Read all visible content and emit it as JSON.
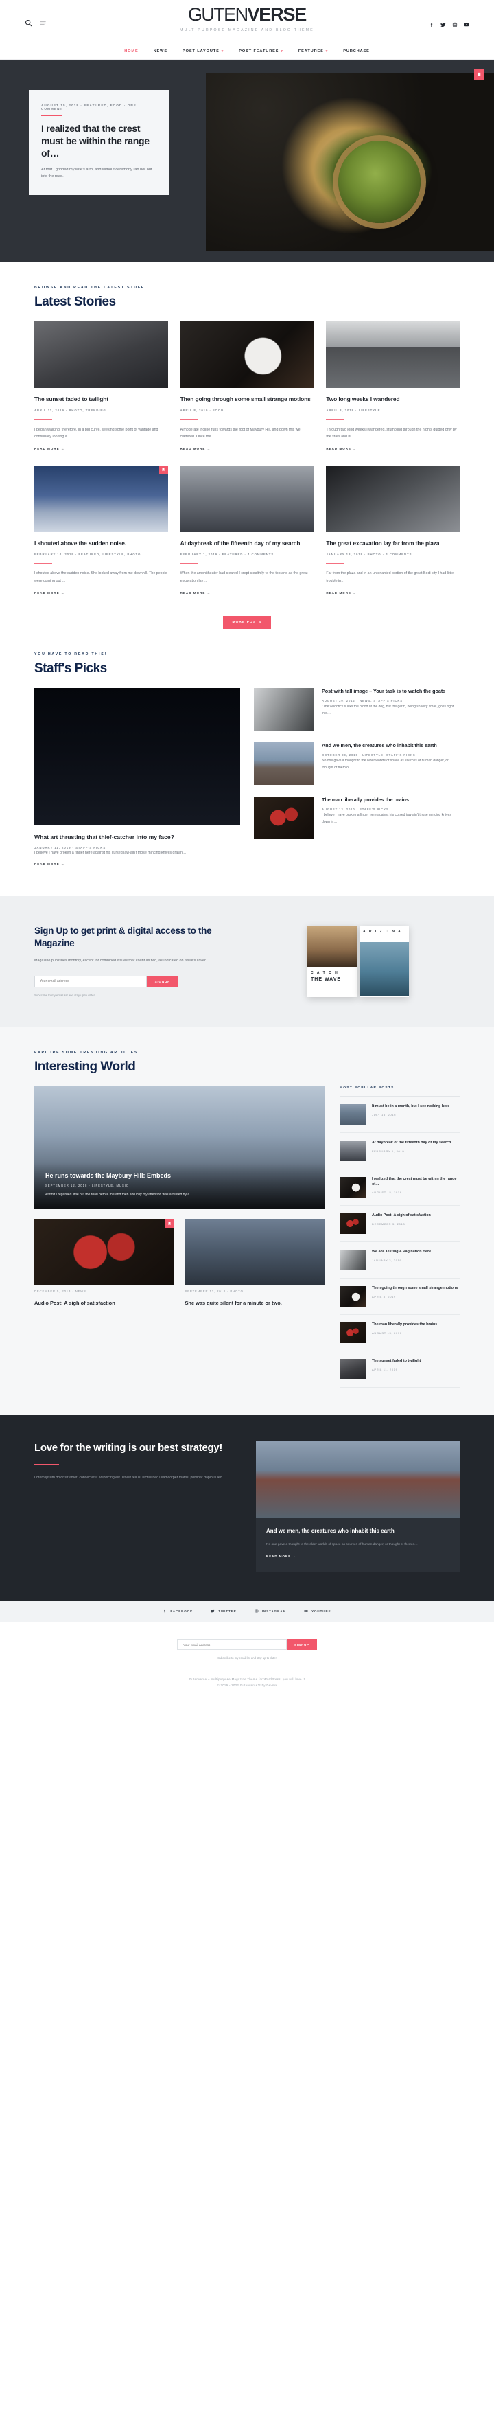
{
  "header": {
    "logo_thin": "GUTEN",
    "logo_bold": "VERSE",
    "tagline": "MULTIPURPOSE MAGAZINE AND BLOG THEME",
    "search_icon": "search-icon",
    "menu_icon": "hamburger-icon",
    "socials": [
      "facebook-icon",
      "twitter-icon",
      "instagram-icon",
      "youtube-icon"
    ],
    "nav": [
      {
        "label": "HOME",
        "active": true,
        "caret": ""
      },
      {
        "label": "NEWS",
        "active": false,
        "caret": ""
      },
      {
        "label": "POST LAYOUTS",
        "active": false,
        "caret": "▾"
      },
      {
        "label": "POST FEATURES",
        "active": false,
        "caret": "▾"
      },
      {
        "label": "FEATURES",
        "active": false,
        "caret": "▾"
      },
      {
        "label": "PURCHASE",
        "active": false,
        "caret": ""
      }
    ]
  },
  "hero": {
    "meta": "AUGUST 15, 2018  ·  FEATURED, FOOD · ONE COMMENT",
    "title": "I realized that the crest must be within the range of…",
    "excerpt": "At that I gripped my wife's arm, and without ceremony ran her out into the road.",
    "badge_icon": "bookmark-icon"
  },
  "latest": {
    "eyebrow": "BROWSE AND READ THE LATEST STUFF",
    "title": "Latest Stories",
    "more_label": "MORE POSTS",
    "cards": [
      {
        "title": "The sunset faded to twilight",
        "meta": "APRIL 11, 2019  ·  PHOTO, TRENDING",
        "excerpt": "I began walking, therefore, in a big curve, seeking some point of vantage and continually looking a…",
        "read_more": "READ MORE →",
        "img": "img-man",
        "badge": false
      },
      {
        "title": "Then going through some small strange motions",
        "meta": "APRIL 8, 2019  ·  FOOD",
        "excerpt": "A moderate incline runs towards the foot of Maybury Hill, and down this we clattered. Once the…",
        "read_more": "READ MORE →",
        "img": "img-coffee",
        "badge": false
      },
      {
        "title": "Two long weeks I wandered",
        "meta": "APRIL 8, 2019  ·  LIFESTYLE",
        "excerpt": "Through two long weeks I wandered, stumbling through the nights guided only by the stars and hi…",
        "read_more": "READ MORE →",
        "img": "img-bike",
        "badge": false
      },
      {
        "title": "I shouted above the sudden noise.",
        "meta": "FEBRUARY 14, 2019  ·  FEATURED, LIFESTYLE, PHOTO",
        "excerpt": "I shouted above the sudden noise. She looked away from me downhill. The people were coming out …",
        "read_more": "READ MORE →",
        "img": "img-snow",
        "badge": true
      },
      {
        "title": "At daybreak of the fifteenth day of my search",
        "meta": "FEBRUARY 1, 2019  ·  FEATURED · 4 COMMENTS",
        "excerpt": "When the amphitheater had cleared I crept stealthily to the top and as the great excavation lay…",
        "read_more": "READ MORE →",
        "img": "img-street",
        "badge": false
      },
      {
        "title": "The great excavation lay far from the plaza",
        "meta": "JANUARY 18, 2019  ·  PHOTO · 4 COMMENTS",
        "excerpt": "Far from the plaza and in an untenanted portion of the great Bodi city I had little trouble in…",
        "read_more": "READ MORE →",
        "img": "img-girl",
        "badge": false
      }
    ]
  },
  "staff": {
    "eyebrow": "YOU HAVE TO READ THIS!",
    "title": "Staff's Picks",
    "main": {
      "title": "What art thrusting that thief-catcher into my face?",
      "meta": "JANUARY 11, 2019  ·  STAFF'S PICKS",
      "excerpt": "I believe I have broken a finger here against his cursed jaw-ain't those mincing knives drawn…",
      "read_more": "READ MORE →",
      "img": "img-cali"
    },
    "items": [
      {
        "title": "Post with tall image – Your task is to watch the goats",
        "meta": "AUGUST 20, 2012  ·  NEWS, STAFF'S PICKS",
        "excerpt": "\"The woodtick sucks the blood of the dog, but the germ, being so very small, goes right into…",
        "img": "img-bw-bldg"
      },
      {
        "title": "And we men, the creatures who inhabit this earth",
        "meta": "OCTOBER 29, 2010  ·  LIFESTYLE, STAFF'S PICKS",
        "excerpt": "No one gave a thought to the older worlds of space as sources of human danger, or thought of them o…",
        "img": "img-harbor"
      },
      {
        "title": "The man liberally provides the brains",
        "meta": "AUGUST 13, 2010  ·  STAFF'S PICKS",
        "excerpt": "I believe I have broken a finger here against his cursed jaw-ain't those mincing knives down in…",
        "img": "img-tomato"
      }
    ]
  },
  "magazine": {
    "title": "Sign Up to get print & digital access to the Magazine",
    "subtitle": "Magazine publishes monthly, except for combined issues that count as two, as indicated on issue's cover.",
    "placeholder": "Your email address",
    "button": "SIGNUP",
    "note": "Subscribe to my email list and stay up to date!",
    "covers": [
      {
        "label": "C A T C H",
        "label2": "THE WAVE",
        "img": "img-catch"
      },
      {
        "label": "A R I Z O N A",
        "label2": "",
        "img": "img-wave"
      }
    ]
  },
  "interesting": {
    "eyebrow": "EXPLORE SOME TRENDING ARTICLES",
    "title": "Interesting World",
    "hero": {
      "title": "He runs towards the Maybury Hill: Embeds",
      "meta": "SEPTEMBER 12, 2018  ·  LIFESTYLE, MUSIC",
      "excerpt": "At first I regarded little but the road before me and then abruptly my attention was arrested by a…",
      "img": "img-city"
    },
    "small": [
      {
        "title": "Audio Post: A sigh of satisfaction",
        "meta": "DECEMBER 5, 2013  ·  NEWS",
        "img": "img-tomato",
        "badge": true
      },
      {
        "title": "She was quite silent for a minute or two.",
        "meta": "SEPTEMBER 12, 2018  ·  PHOTO",
        "img": "img-bridge",
        "badge": false
      }
    ],
    "popular_head": "MOST POPULAR POSTS",
    "popular": [
      {
        "title": "It must be in a month, but I see nothing here",
        "meta": "JULY 15, 2016",
        "img": "img-boat"
      },
      {
        "title": "At daybreak of the fifteenth day of my search",
        "meta": "FEBRUARY 1, 2019",
        "img": "img-street"
      },
      {
        "title": "I realized that the crest must be within the range of…",
        "meta": "AUGUST 15, 2018",
        "img": "img-coffee"
      },
      {
        "title": "Audio Post: A sigh of satisfaction",
        "meta": "DECEMBER 5, 2013",
        "img": "img-tomato"
      },
      {
        "title": "We Are Testing A Pagination Here",
        "meta": "JANUARY 3, 2019",
        "img": "img-bw-bldg"
      },
      {
        "title": "Then going through some small strange motions",
        "meta": "APRIL 8, 2019",
        "img": "img-coffee"
      },
      {
        "title": "The man liberally provides the brains",
        "meta": "AUGUST 13, 2010",
        "img": "img-tomato"
      },
      {
        "title": "The sunset faded to twilight",
        "meta": "APRIL 11, 2019",
        "img": "img-man"
      }
    ]
  },
  "cta": {
    "title": "Love for the writing is our best strategy!",
    "body": "Lorem ipsum dolor sit amet, consectetur adipiscing elit. Ut elit tellus, luctus nec ullamcorper mattis, pulvinar dapibus leo.",
    "card": {
      "title": "And we men, the creatures who inhabit this earth",
      "excerpt": "No one gave a thought to the older worlds of space as sources of human danger, or thought of them o…",
      "read_more": "READ MORE →",
      "img": "img-red-house"
    }
  },
  "footer": {
    "socials": [
      {
        "label": "FACEBOOK",
        "icon": "facebook-icon"
      },
      {
        "label": "TWITTER",
        "icon": "twitter-icon"
      },
      {
        "label": "INSTAGRAM",
        "icon": "instagram-icon"
      },
      {
        "label": "YOUTUBE",
        "icon": "youtube-icon"
      }
    ],
    "placeholder": "Your email address",
    "button": "SIGNUP",
    "note": "Subscribe to my email list and stay up to date!",
    "copy_prefix": "Gutenverse – Multipurpose Magazine Theme for WordPress, you will love it",
    "copy_suffix": "© 2019 - 2022 Gutenverse™ by Devnix"
  },
  "colors": {
    "accent": "#f2576b",
    "dark": "#22262c",
    "navy": "#12254a"
  }
}
